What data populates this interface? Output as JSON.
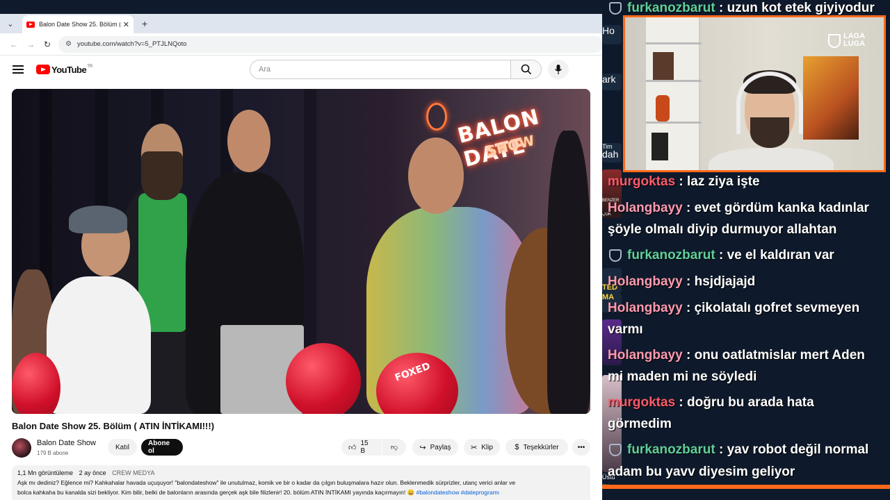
{
  "browser": {
    "tab_title": "Balon Date Show 25. Bölüm ( AT",
    "url": "youtube.com/watch?v=5_PTJLNQoto"
  },
  "youtube": {
    "logo_text": "YouTube",
    "logo_region": "TR",
    "search_placeholder": "Ara"
  },
  "video": {
    "neon_line1": "BALON DATE",
    "neon_line2": "SHOW",
    "balloon_text": "FOXED",
    "title": "Balon Date Show 25. Bölüm ( ATIN İNTİKAMI!!!)"
  },
  "channel": {
    "name": "Balon Date Show",
    "subscribers": "179 B abone",
    "join_label": "Katıl",
    "subscribe_label": "Abone ol"
  },
  "actions": {
    "likes": "15 B",
    "share": "Paylaş",
    "clip": "Klip",
    "thanks": "Teşekkürler"
  },
  "description": {
    "views": "1,1 Mn görüntüleme",
    "age": "2 ay önce",
    "credit": "CREW MEDYA",
    "text_line1": "Aşk mı dediniz? Eğlence mi? Kahkahalar havada uçuşuyor! \"balondateshow\" ile unutulmaz, komik ve bir o kadar da çılgın buluşmalara hazır olun. Beklenmedik sürprizler, utanç verici anlar ve",
    "text_line2": "bolca kahkaha bu kanalda sizi bekliyor. Kim bilir, belki de balonların arasında gerçek aşk bile filizlenir! 20. bölüm ATIN İNTİKAMI yayında kaçırmayın! 😄",
    "hashtags": "#balondateshow #dateprogramı"
  },
  "stream": {
    "logo_line1": "LAGA",
    "logo_line2": "LUGA",
    "side_thumbs": [
      "Ho",
      "ark",
      "Tim",
      "dah",
      "BENZER",
      "ÇOK",
      "TED",
      "MA",
      "Üstü",
      "İftira"
    ],
    "chat": [
      {
        "user": "furkanozbarut",
        "text": " : uzun kot etek giyiyodur"
      },
      {
        "user": "murgoktas",
        "text": " : laz ziya işte"
      },
      {
        "user": "Holangbayy",
        "text": " : evet gördüm kanka kadınlar"
      },
      {
        "user": "",
        "text": "şöyle olmalı diyip durmuyor allahtan"
      },
      {
        "user": "furkanozbarut",
        "text": " : ve el kaldıran var"
      },
      {
        "user": "Holangbayy",
        "text": " : hsjdjajajd"
      },
      {
        "user": "Holangbayy",
        "text": " : çikolatalı gofret sevmeyen"
      },
      {
        "user": "",
        "text": "varmı"
      },
      {
        "user": "Holangbayy",
        "text": " : onu oatlatmislar mert Aden"
      },
      {
        "user": "",
        "text": "mi maden mi ne söyledi"
      },
      {
        "user": "murgoktas",
        "text": " : doğru bu arada hata"
      },
      {
        "user": "",
        "text": "görmedim"
      },
      {
        "user": "furkanozbarut",
        "text": " : yav robot değil normal"
      },
      {
        "user": "",
        "text": "adam bu yavv diyesim geliyor"
      }
    ]
  },
  "colors": {
    "accent_orange": "#ff6a1a",
    "chat_user_green": "#5fd09a",
    "chat_user_pink": "#ff9ab0",
    "chat_user_red": "#ff5a6a",
    "panel_bg": "#0e1a2b"
  }
}
